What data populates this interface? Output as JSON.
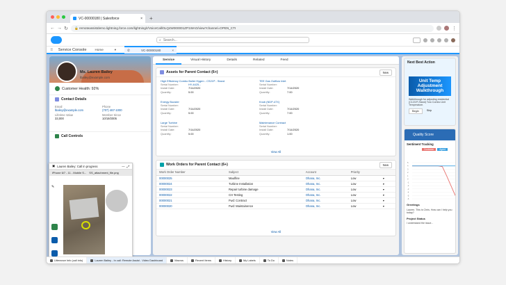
{
  "browser": {
    "tab_title": "VC-00000180 | Salesforce",
    "url": "remoteassistdemo.lightning.force.com/lightning/r/VoiceCall/0LQ4W000001ZP1WAO/view?channel=OPEN_CTI"
  },
  "app": {
    "name": "Service Console",
    "tab_home": "Home",
    "tab_record": "VC-00000180",
    "search_placeholder": "Search..."
  },
  "contact": {
    "name": "Ms. Lauren Bailey",
    "email": "lbailey@example.com",
    "health": "Customer Health: 92%",
    "details_title": "Contact Details",
    "email_label": "Email",
    "email_value": "lbailey@example.com",
    "phone_label": "Phone",
    "phone_value": "(707) 467-1000",
    "lifetime_label": "Lifetime Value",
    "lifetime_value": "33,000",
    "member_label": "Member Since",
    "member_value": "10/19/2005",
    "call_controls": "Call Controls"
  },
  "call_popup": {
    "status": "Lauren Bailey: Call in progress",
    "device": "iPhone 6/7 - 11 - Mobile S...",
    "feed": "SS_attachment_file.png"
  },
  "center_tabs": [
    "Service",
    "Visual History",
    "Details",
    "Related",
    "Feed"
  ],
  "assets": {
    "title": "Assets for Parent Contact (6+)",
    "new": "New",
    "view_all": "View All",
    "items": [
      {
        "name": "High Efficiency Combo Boiler Hygen - CS21P - Stand",
        "sn_label": "Serial Number:",
        "sn": "HY-4425...",
        "ins_label": "Install Date:",
        "ins": "7/14/2020",
        "qty_label": "Quantity:",
        "qty": "5.00"
      },
      {
        "name": "TEE Gas Outflow Inlet",
        "sn_label": "Serial Number:",
        "sn": "",
        "ins_label": "Install Date:",
        "ins": "7/14/2020",
        "qty_label": "Quantity:",
        "qty": "7.00"
      },
      {
        "name": "Energy Booster",
        "sn_label": "Serial Number:",
        "sn": "",
        "ins_label": "Install Date:",
        "ins": "7/14/2020",
        "qty_label": "Quantity:",
        "qty": "5.00"
      },
      {
        "name": "Knob (NDP-47X)",
        "sn_label": "Serial Number:",
        "sn": "",
        "ins_label": "Install Date:",
        "ins": "7/14/2020",
        "qty_label": "Quantity:",
        "qty": "7.00"
      },
      {
        "name": "Large Turbine",
        "sn_label": "Serial Number:",
        "sn": "",
        "ins_label": "Install Date:",
        "ins": "7/14/2020",
        "qty_label": "Quantity:",
        "qty": "5.00"
      },
      {
        "name": "Maintenance Contract",
        "sn_label": "Serial Number:",
        "sn": "",
        "ins_label": "Install Date:",
        "ins": "7/14/2020",
        "qty_label": "Quantity:",
        "qty": "1.00"
      }
    ]
  },
  "work_orders": {
    "title": "Work Orders for Parent Contact (6+)",
    "new": "New",
    "view_all": "View All",
    "columns": [
      "Work Order Number",
      "Subject",
      "Account",
      "Priority"
    ],
    "rows": [
      [
        "00000025",
        "Maulfine",
        "Ohana, Inc.",
        "Low"
      ],
      [
        "00000024",
        "Turbine Installation",
        "Ohana, Inc.",
        "Low"
      ],
      [
        "00000023",
        "Repair turbine damage",
        "Ohana, Inc.",
        "Low"
      ],
      [
        "00000022",
        "CH Testing",
        "Ohana, Inc.",
        "Low"
      ],
      [
        "00000021",
        "Fwd: Contract",
        "Ohana, Inc.",
        "Low"
      ],
      [
        "00000020",
        "Fwd: Maintainence",
        "Ohana, Inc.",
        "Low"
      ]
    ]
  },
  "nba": {
    "title": "Next Best Action",
    "banner": "Unit Temp Adjustment Walkthrough",
    "text": "Walkthrough for adjusting residential (C1/21P-Stand) Toro Combo Unit Temperature.",
    "begin": "Begin",
    "skip": "Skip"
  },
  "quality": {
    "title": "Quality Score",
    "sentiment": "Sentiment Tracking",
    "legend_customer": "Customer",
    "legend_agent": "Agent",
    "greetings": "Greetings",
    "greet_item": "Lauren. This is Chris. How can I help you today?",
    "project": "Project Status",
    "proj_item": "I understand the issue..."
  },
  "chart_data": {
    "type": "line",
    "title": "Sentiment Tracking",
    "series": [
      {
        "name": "Customer",
        "values": [
          4,
          4,
          4,
          4,
          4,
          4,
          4,
          3.8,
          1,
          -2,
          -5
        ]
      },
      {
        "name": "Agent",
        "values": [
          4,
          4,
          4,
          4,
          4,
          4,
          4,
          4,
          4,
          4,
          4
        ]
      }
    ],
    "ylim": [
      -6,
      5
    ],
    "colors": {
      "Customer": "#e8716d",
      "Agent": "#3aa0e0"
    }
  },
  "footer": [
    "Utterance Info (call info)",
    "Lauren Bailey - In call: Remote Assist - Video Dashboard",
    "Macros",
    "Recent Items",
    "History",
    "My Labels",
    "To Do",
    "Notes"
  ],
  "colors": {
    "brand": "#1b96ff",
    "header_gradient_start": "#78a9d1"
  }
}
